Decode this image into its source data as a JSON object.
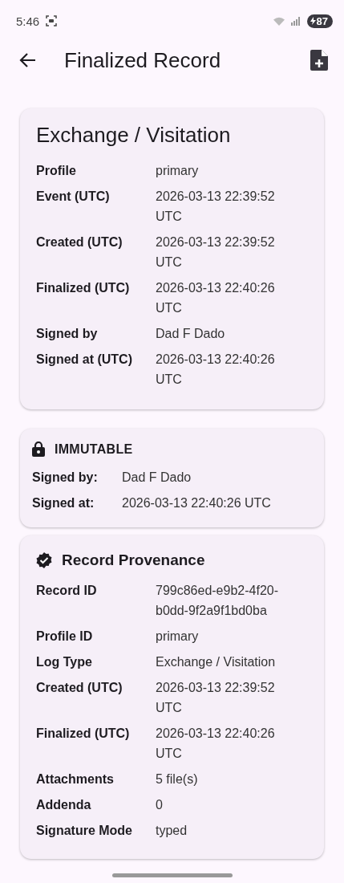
{
  "status_bar": {
    "time": "5:46",
    "battery": "87"
  },
  "app_bar": {
    "title": "Finalized Record"
  },
  "record_card": {
    "title": "Exchange / Visitation",
    "fields": [
      {
        "label": "Profile",
        "value": "primary"
      },
      {
        "label": "Event (UTC)",
        "value": "2026-03-13  22:39:52 UTC"
      },
      {
        "label": "Created (UTC)",
        "value": "2026-03-13  22:39:52 UTC"
      },
      {
        "label": "Finalized (UTC)",
        "value": "2026-03-13  22:40:26 UTC"
      },
      {
        "label": "Signed by",
        "value": "Dad F Dado"
      },
      {
        "label": "Signed at (UTC)",
        "value": "2026-03-13  22:40:26 UTC"
      }
    ]
  },
  "immutable_card": {
    "title": "IMMUTABLE",
    "fields": [
      {
        "label": "Signed by:",
        "value": "Dad F Dado"
      },
      {
        "label": "Signed at:",
        "value": "2026-03-13 22:40:26 UTC"
      }
    ]
  },
  "provenance_card": {
    "title": "Record Provenance",
    "fields": [
      {
        "label": "Record ID",
        "value": "799c86ed-e9b2-4f20-b0dd-9f2a9f1bd0ba"
      },
      {
        "label": "Profile ID",
        "value": "primary"
      },
      {
        "label": "Log Type",
        "value": "Exchange / Visitation"
      },
      {
        "label": "Created (UTC)",
        "value": "2026-03-13  22:39:52 UTC"
      },
      {
        "label": "Finalized (UTC)",
        "value": "2026-03-13  22:40:26 UTC"
      },
      {
        "label": "Attachments",
        "value": "5 file(s)"
      },
      {
        "label": "Addenda",
        "value": "0"
      },
      {
        "label": "Signature Mode",
        "value": "typed"
      }
    ]
  }
}
